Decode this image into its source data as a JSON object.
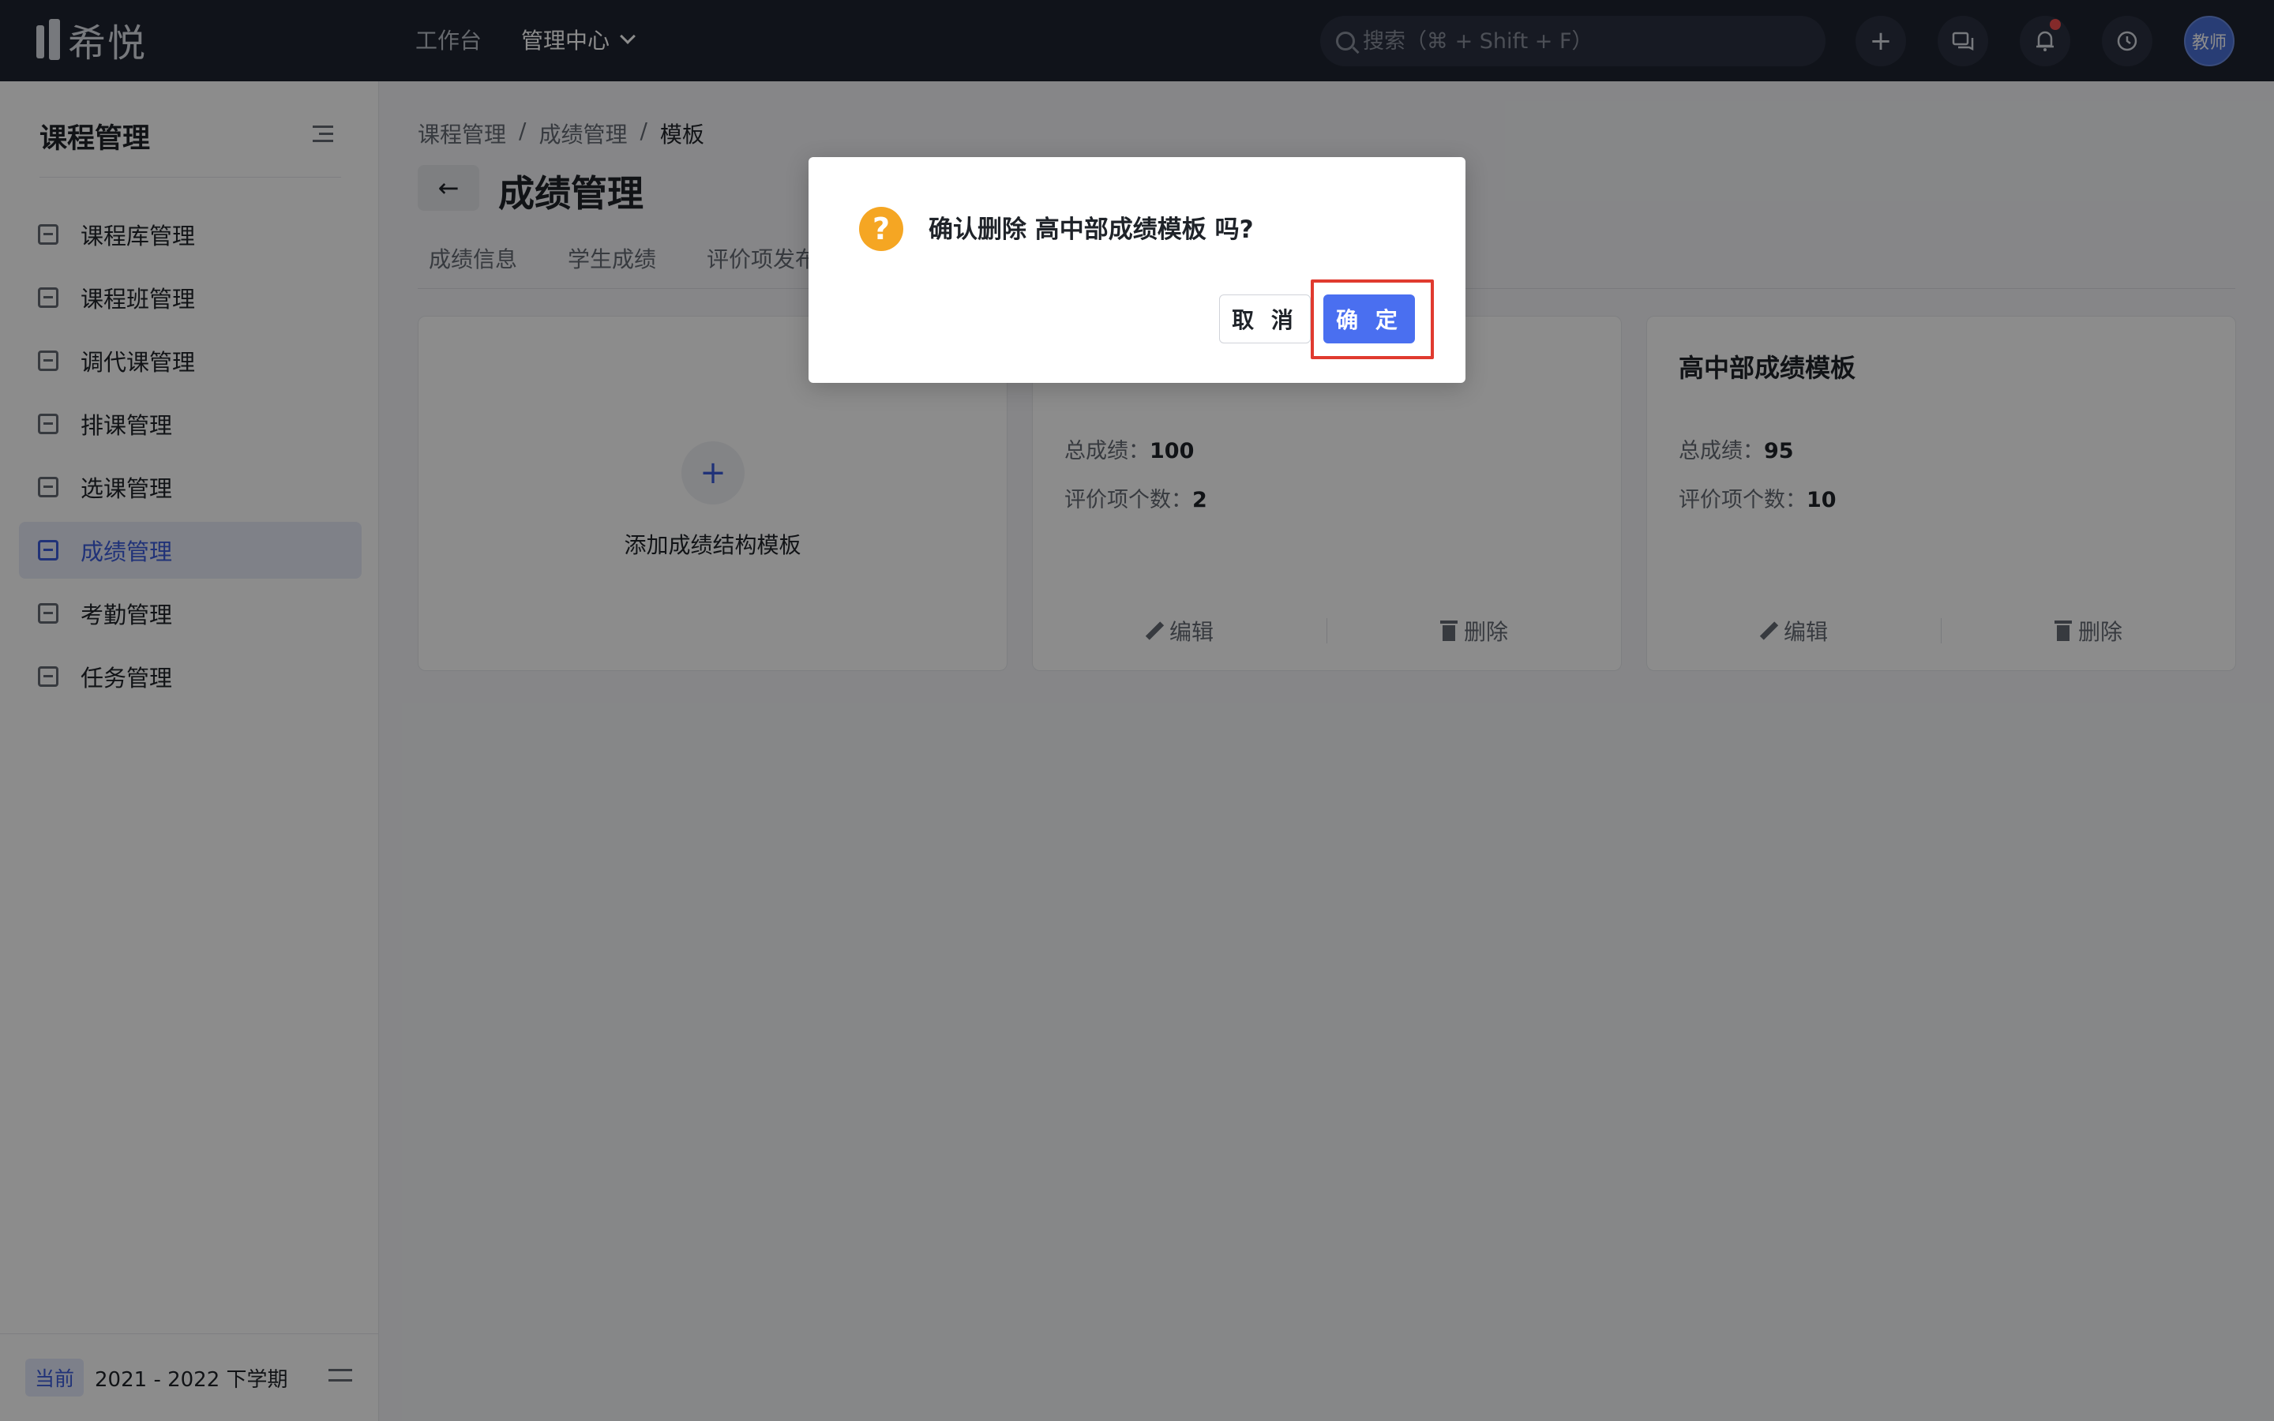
{
  "brand": {
    "name": "希悦"
  },
  "topnav": {
    "workbench": "工作台",
    "admin_center": "管理中心"
  },
  "search": {
    "placeholder": "搜索（⌘ + Shift + F）"
  },
  "top_icons": [
    "plus-icon",
    "chat-icon",
    "bell-icon",
    "clock-icon"
  ],
  "user": {
    "avatar_text": "教师"
  },
  "sidebar": {
    "title": "课程管理",
    "items": [
      {
        "label": "课程库管理",
        "icon": "library-icon"
      },
      {
        "label": "课程班管理",
        "icon": "class-icon"
      },
      {
        "label": "调代课管理",
        "icon": "substitute-icon"
      },
      {
        "label": "排课管理",
        "icon": "schedule-icon"
      },
      {
        "label": "选课管理",
        "icon": "checkbox-icon"
      },
      {
        "label": "成绩管理",
        "icon": "grade-icon",
        "active": true
      },
      {
        "label": "考勤管理",
        "icon": "calendar-icon"
      },
      {
        "label": "任务管理",
        "icon": "tasklist-icon"
      }
    ],
    "footer": {
      "badge": "当前",
      "term": "2021 - 2022 下学期"
    }
  },
  "breadcrumb": {
    "level1": "课程管理",
    "level2": "成绩管理",
    "level3": "模板",
    "sep": "/"
  },
  "page": {
    "title": "成绩管理"
  },
  "tabs": [
    "成绩信息",
    "学生成绩",
    "评价项发布"
  ],
  "add_card": {
    "label": "添加成绩结构模板",
    "plus": "+"
  },
  "cards": [
    {
      "title": "",
      "total_label": "总成绩：",
      "total_value": "100",
      "items_label": "评价项个数：",
      "items_value": "2",
      "edit": "编辑",
      "delete": "删除"
    },
    {
      "title": "高中部成绩模板",
      "total_label": "总成绩：",
      "total_value": "95",
      "items_label": "评价项个数：",
      "items_value": "10",
      "edit": "编辑",
      "delete": "删除"
    }
  ],
  "dialog": {
    "message": "确认删除 高中部成绩模板 吗?",
    "cancel": "取 消",
    "confirm": "确 定",
    "icon_glyph": "?"
  },
  "colors": {
    "topbar": "#1e2330",
    "accent": "#4a6ff0",
    "warning": "#f5a623",
    "highlight": "#e03a2f"
  }
}
